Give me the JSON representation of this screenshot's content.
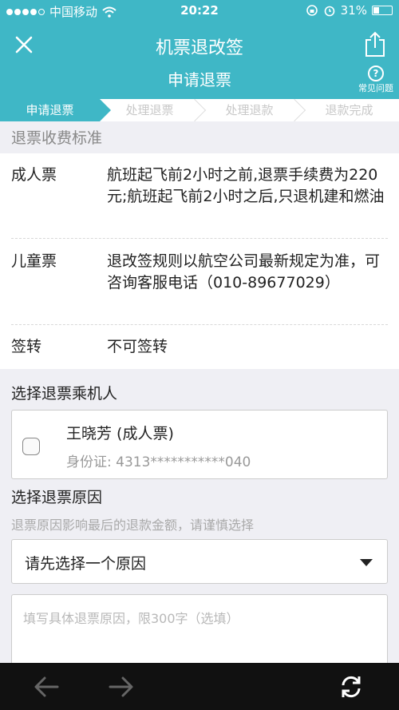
{
  "status": {
    "carrier": "中国移动",
    "time": "20:22",
    "battery": "31%",
    "battery_level": 0.31
  },
  "header": {
    "title": "机票退改签",
    "subtitle": "申请退票",
    "faq_label": "常见问题",
    "close_icon": "close-icon",
    "share_icon": "share-icon"
  },
  "steps": [
    "申请退票",
    "处理退票",
    "处理退款",
    "退款完成"
  ],
  "refund_rules": {
    "title": "退票收费标准",
    "rows": [
      {
        "key": "成人票",
        "value": "航班起飞前2小时之前,退票手续费为220元;航班起飞前2小时之后,只退机建和燃油"
      },
      {
        "key": "儿童票",
        "value": "退改签规则以航空公司最新规定为准，可咨询客服电话（010-89677029）"
      },
      {
        "key": "签转",
        "value": "不可签转"
      }
    ]
  },
  "passenger": {
    "title": "选择退票乘机人",
    "name": "王晓芳 (成人票)",
    "id": "身份证: 4313***********040",
    "checked": false
  },
  "reason": {
    "title": "选择退票原因",
    "hint": "退票原因影响最后的退款金额，请谨慎选择",
    "select_label": "请先选择一个原因",
    "textarea_placeholder": "填写具体退票原因，限300字（选填）"
  },
  "toolbar": {
    "back_icon": "arrow-left-icon",
    "forward_icon": "arrow-right-icon",
    "refresh_icon": "refresh-icon"
  }
}
